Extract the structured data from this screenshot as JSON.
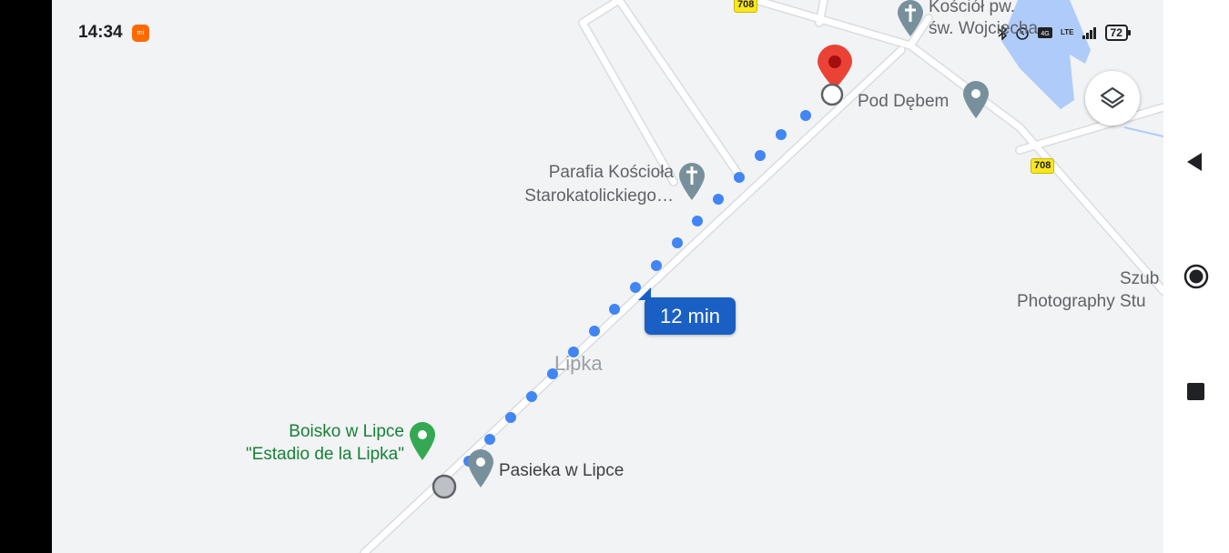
{
  "status_bar": {
    "time": "14:34",
    "network": "LTE",
    "battery": "72"
  },
  "map": {
    "labels": {
      "church_line1": "Kościół pw.",
      "church_line2": "św. Wojciecha",
      "pod_debem": "Pod Dębem",
      "parafia_line1": "Parafia Kościoła",
      "parafia_line2": "Starokatolickiego…",
      "photo_line1": "Szub",
      "photo_line2": "Photography Stu",
      "lipka": "Lipka",
      "boisko_line1": "Boisko w Lipce",
      "boisko_line2": "\"Estadio de la Lipka\"",
      "pasieka": "Pasieka w Lipce"
    },
    "road_shield_top": "708",
    "road_shield_right": "708",
    "eta": "12 min"
  },
  "colors": {
    "map_bg": "#f1f3f4",
    "route_dot": "#4285f4",
    "eta_bg": "#1a5fc4",
    "water": "#aecbfa",
    "destination_pin": "#ea4335",
    "poi_gray": "#78909c",
    "poi_green": "#34a853"
  },
  "icons": {
    "layers": "layers-icon",
    "back": "back-triangle-icon",
    "home": "home-circle-icon",
    "recents": "recents-square-icon"
  }
}
